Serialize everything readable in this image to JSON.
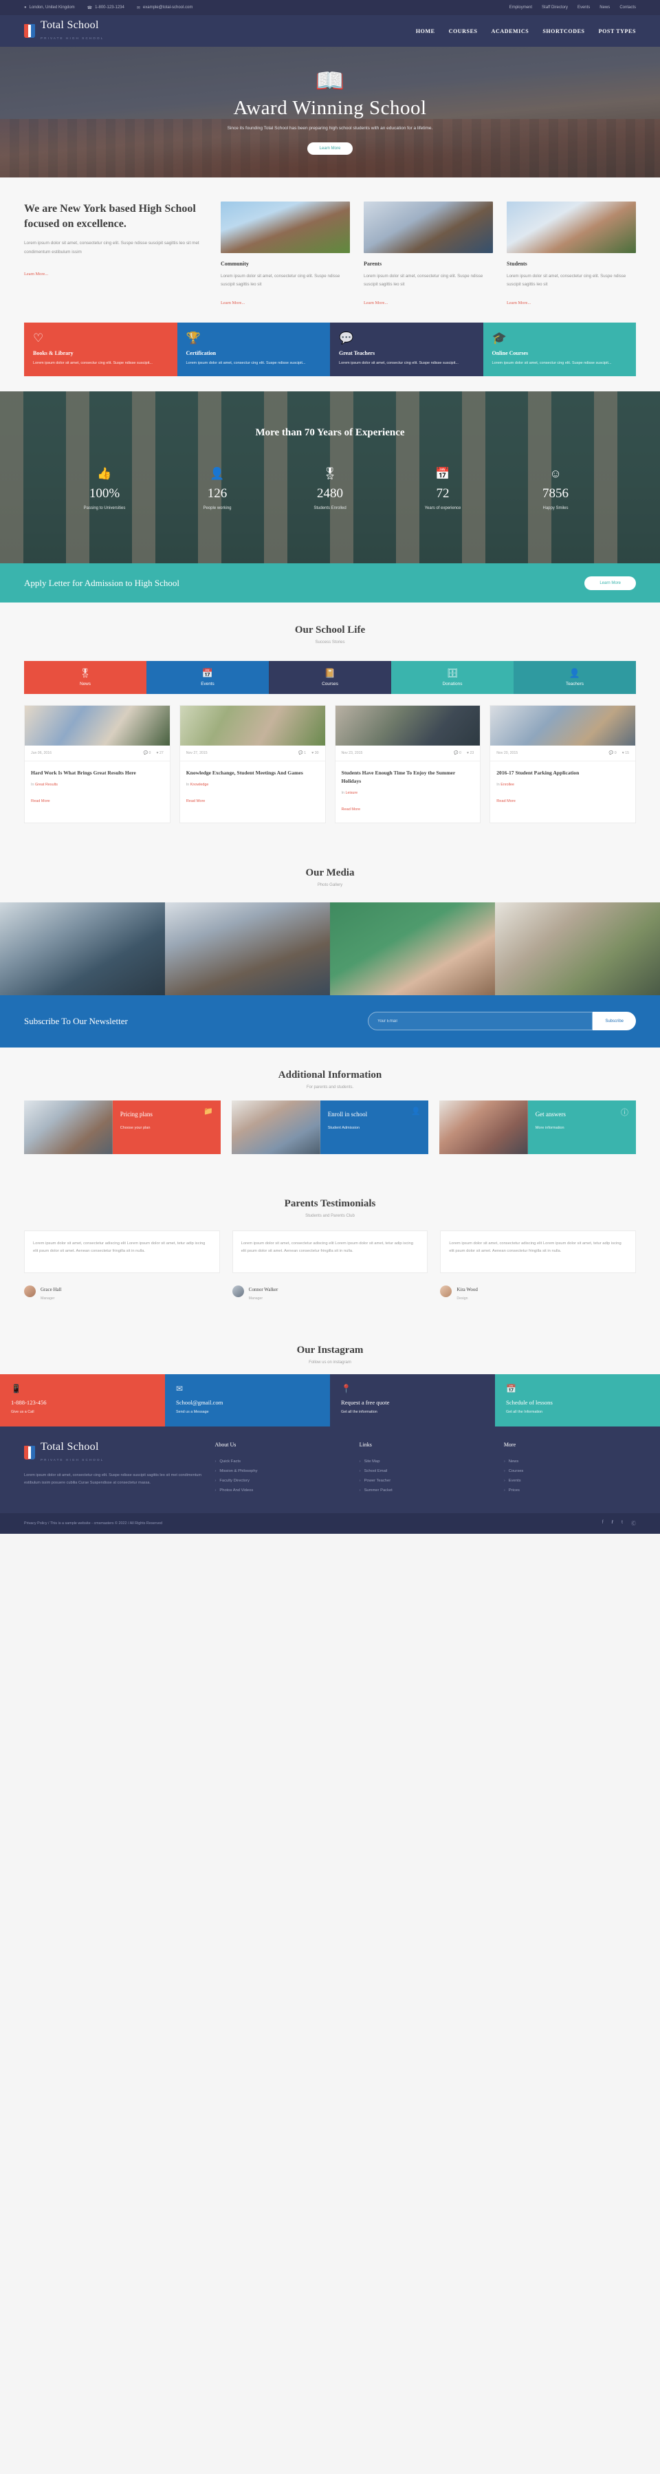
{
  "topbar": {
    "location": "London, United Kingdom",
    "phone": "1-800-123-1234",
    "email": "example@total-school.com",
    "links": [
      "Employment",
      "Staff Directory",
      "Events",
      "News",
      "Contacts"
    ]
  },
  "header": {
    "logo_name": "Total School",
    "logo_sub": "PRIVATE HIGH SCHOOL",
    "nav": [
      "HOME",
      "COURSES",
      "ACADEMICS",
      "SHORTCODES",
      "POST TYPES"
    ]
  },
  "hero": {
    "icon": "book-open-icon",
    "title": "Award Winning School",
    "subtitle": "Since its founding Total School has been preparing high school students with an education for a lifetime.",
    "button": "Learn More"
  },
  "about": {
    "heading": "We are New York based High School focused on excellence.",
    "paragraph": "Lorem ipsum dolor sit amet, consectetur cing elit. Suspe ndisse suscipit sagittis leo sit met condimentum estibulum issim",
    "link": "Learn More...",
    "cards": [
      {
        "title": "Community",
        "text": "Lorem ipsum dolor sit amet, consectetur cing elit. Suspe ndisse suscipit sagittis leo sit",
        "link": "Learn More..."
      },
      {
        "title": "Parents",
        "text": "Lorem ipsum dolor sit amet, consectetur cing elit. Suspe ndisse suscipit sagittis leo sit",
        "link": "Learn More..."
      },
      {
        "title": "Students",
        "text": "Lorem ipsum dolor sit amet, consectetur cing elit. Suspe ndisse suscipit sagittis leo sit",
        "link": "Learn More..."
      }
    ]
  },
  "features": [
    {
      "icon": "book-heart-icon",
      "title": "Books & Library",
      "text": "Lorem ipsum dolor sit amet, consectur cing elit. Suspe ndisse suscipit...",
      "color": "#e8503f"
    },
    {
      "icon": "trophy-certificate-icon",
      "title": "Certification",
      "text": "Lorem ipsum dolor sit amet, consectur cing elit. Suspe ndisse suscipit...",
      "color": "#1f6fb6"
    },
    {
      "icon": "teachers-icon",
      "title": "Great Teachers",
      "text": "Lorem ipsum dolor sit amet, consectur cing elit. Suspe ndisse suscipit...",
      "color": "#333a5e"
    },
    {
      "icon": "graduation-cap-icon",
      "title": "Online Courses",
      "text": "Lorem ipsum dolor sit amet, consectur cing elit. Suspe ndisse suscipit...",
      "color": "#3ab4ad"
    }
  ],
  "stats": {
    "heading": "More than 70 Years of Experience",
    "items": [
      {
        "icon": "thumbs-up-icon",
        "value": "100%",
        "label": "Passing to Universities"
      },
      {
        "icon": "people-icon",
        "value": "126",
        "label": "People working"
      },
      {
        "icon": "award-ribbon-icon",
        "value": "2480",
        "label": "Students Enrolled"
      },
      {
        "icon": "calendar-icon",
        "value": "72",
        "label": "Years of experience"
      },
      {
        "icon": "smiley-icon",
        "value": "7856",
        "label": "Happy Smiles"
      }
    ]
  },
  "apply": {
    "title": "Apply Letter for Admission to High School",
    "button": "Learn More"
  },
  "school_life": {
    "heading": "Our School Life",
    "subheading": "Success Stories",
    "tabs": [
      {
        "icon": "award-ribbon-icon",
        "label": "News",
        "color": "#e8503f"
      },
      {
        "icon": "calendar-icon",
        "label": "Events",
        "color": "#1f6fb6"
      },
      {
        "icon": "book-icon",
        "label": "Courses",
        "color": "#333a5e"
      },
      {
        "icon": "donation-box-icon",
        "label": "Donations",
        "color": "#3ab4ad"
      },
      {
        "icon": "teacher-icon",
        "label": "Teachers",
        "color": "#2f9aa0"
      }
    ],
    "posts": [
      {
        "date": "Jun 06, 2016",
        "comments": "0",
        "likes": "27",
        "title": "Hard Work Is What Brings Great Results Here",
        "in_label": "In",
        "category": "Great Results",
        "read": "Read More"
      },
      {
        "date": "Nov 27, 2015",
        "comments": "1",
        "likes": "30",
        "title": "Knowledge Exchange, Student Meetings And Games",
        "in_label": "In",
        "category": "Knowledge",
        "read": "Read More"
      },
      {
        "date": "Nov 23, 2015",
        "comments": "0",
        "likes": "23",
        "title": "Students Have Enough Time To Enjoy the Summer Holidays",
        "in_label": "In",
        "category": "Leisure",
        "read": "Read More"
      },
      {
        "date": "Nov 20, 2015",
        "comments": "0",
        "likes": "15",
        "title": "2016-17 Student Parking Application",
        "in_label": "In",
        "category": "Enrollee",
        "read": "Read More"
      }
    ]
  },
  "media": {
    "heading": "Our Media",
    "subheading": "Photo Gallery"
  },
  "newsletter": {
    "title": "Subscribe To Our Newsletter",
    "placeholder": "Your Email",
    "button": "Subscribe"
  },
  "additional": {
    "heading": "Additional Information",
    "subheading": "For parents and students.",
    "boxes": [
      {
        "icon": "folder-icon",
        "title": "Pricing plans",
        "sub": "Choose your plan",
        "color": "#e8503f"
      },
      {
        "icon": "user-icon",
        "title": "Enroll in school",
        "sub": "Student Admission",
        "color": "#1f6fb6"
      },
      {
        "icon": "info-icon",
        "title": "Get answers",
        "sub": "More information",
        "color": "#3ab4ad"
      }
    ]
  },
  "testimonials": {
    "heading": "Parents Testimonials",
    "subheading": "Students and Parents Club",
    "items": [
      {
        "quote": "Lorem ipsum dolor sit amet, consectetur adiscing elit Lorem ipsum dolor sit amet, tetur adip iscing elit psum dolor sit amet. Aenean consectetur fringilla sit in nulla.",
        "name": "Grace Hall",
        "role": "Manager"
      },
      {
        "quote": "Lorem ipsum dolor sit amet, consectetur adiscing elit Lorem ipsum dolor sit amet, tetur adip iscing elit psum dolor sit amet. Aenean consectetur fringilla sit in nulla.",
        "name": "Connor Walker",
        "role": "Manager"
      },
      {
        "quote": "Lorem ipsum dolor sit amet, consectetur adiscing elit Lorem ipsum dolor sit amet, tetur adip iscing elit psum dolor sit amet. Aenean consectetur fringilla sit in nulla.",
        "name": "Kira Wood",
        "role": "Design"
      }
    ]
  },
  "instagram": {
    "heading": "Our Instagram",
    "subheading": "Follow us on instagram"
  },
  "contact_strip": [
    {
      "icon": "phone-icon",
      "title": "1-888-123-456",
      "sub": "Give us a Call",
      "color": "#e8503f"
    },
    {
      "icon": "mail-icon",
      "title": "School@gmail.com",
      "sub": "Send us a Message",
      "color": "#1f6fb6"
    },
    {
      "icon": "pin-icon",
      "title": "Request a free quote",
      "sub": "Get all the information",
      "color": "#333a5e"
    },
    {
      "icon": "calendar-icon",
      "title": "Schedule of lessons",
      "sub": "Get all the Information",
      "color": "#3ab4ad"
    }
  ],
  "footer": {
    "logo_name": "Total School",
    "logo_sub": "PRIVATE HIGH SCHOOL",
    "about": "Lorem ipsum dolor sit amet, consectetur cing elit. Suspe ndisse suscipit sagittis leo sit met condimentum estibulum issim posuere cubilia Curae Suspendisse at consectetur massa.",
    "columns": [
      {
        "heading": "About Us",
        "links": [
          "Quick Facts",
          "Mission & Philosophy",
          "Faculty Directory",
          "Photos And Videos"
        ]
      },
      {
        "heading": "Links",
        "links": [
          "Site Map",
          "School Email",
          "Power Teacher",
          "Summer Packet"
        ]
      },
      {
        "heading": "More",
        "links": [
          "News",
          "Courses",
          "Events",
          "Prices"
        ]
      }
    ],
    "copyright": "Privacy Policy / This is a sample website - cmsmasters © 2022 / All Rights Reserved",
    "social": [
      "f",
      "𝒕",
      "t",
      "Ⓒ"
    ]
  }
}
